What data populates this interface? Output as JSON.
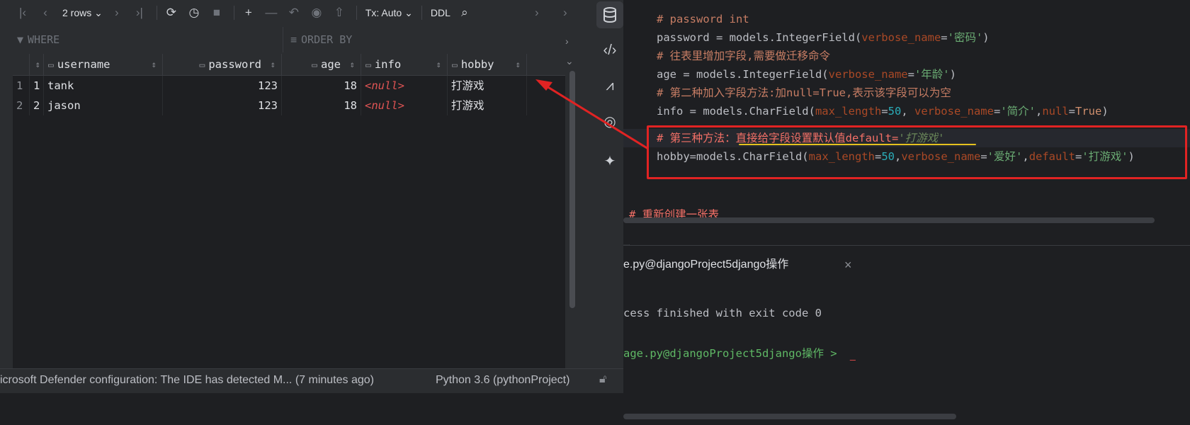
{
  "toolbar": {
    "rows_label": "2 rows",
    "tx_label": "Tx: Auto",
    "ddl_label": "DDL"
  },
  "filters": {
    "where": "WHERE",
    "order_by": "ORDER BY"
  },
  "grid": {
    "columns": [
      "username",
      "password",
      "age",
      "info",
      "hobby"
    ],
    "rows": [
      {
        "rownum": "1",
        "id": "1",
        "username": "tank",
        "password": "123",
        "age": "18",
        "info": "<null>",
        "hobby": "打游戏"
      },
      {
        "rownum": "2",
        "id": "2",
        "username": "jason",
        "password": "123",
        "age": "18",
        "info": "<null>",
        "hobby": "打游戏"
      }
    ]
  },
  "code": {
    "l1": "# password int",
    "l2_a": "password = models.IntegerField(",
    "l2_p": "verbose_name",
    "l2_eq": "=",
    "l2_s": "'密码'",
    "l2_e": ")",
    "l3": "# 往表里增加字段,需要做迁移命令",
    "l4_a": "age = models.IntegerField(",
    "l4_p": "verbose_name",
    "l4_eq": "=",
    "l4_s": "'年龄'",
    "l4_e": ")",
    "l5": "# 第二种加入字段方法:加null=True,表示该字段可以为空",
    "l6_a": "info = models.CharField(",
    "l6_p1": "max_length",
    "l6_eq1": "=",
    "l6_n": "50",
    "l6_c1": ", ",
    "l6_p2": "verbose_name",
    "l6_eq2": "=",
    "l6_s": "'简介'",
    "l6_c2": ",",
    "l6_p3": "null",
    "l6_eq3": "=",
    "l6_t": "True",
    "l6_e": ")",
    "l7_a": "# 第三种方法：直接给字段设置默认值default=",
    "l7_s": "'打游戏'",
    "l8_a": "hobby",
    "l8_b": "=models.CharField(",
    "l8_p1": "max_length",
    "l8_eq1": "=",
    "l8_n": "50",
    "l8_c1": ",",
    "l8_p2": "verbose_name",
    "l8_eq2": "=",
    "l8_s1": "'爱好'",
    "l8_c2": ",",
    "l8_p3": "default",
    "l8_eq3": "=",
    "l8_s2": "'打游戏'",
    "l8_e": ")",
    "l9": "# 重新创建一张表"
  },
  "run": {
    "tab_title": "e.py@djangoProject5django操作",
    "close": "×",
    "output": "cess finished with exit code 0",
    "prompt": "age.py@djangoProject5django操作 >"
  },
  "status": {
    "message": "icrosoft Defender configuration: The IDE has detected M... (7 minutes ago)",
    "interpreter": "Python 3.6 (pythonProject)"
  },
  "colors": {
    "annotation_red": "#e12323",
    "underline_yellow": "#e5c21e"
  }
}
